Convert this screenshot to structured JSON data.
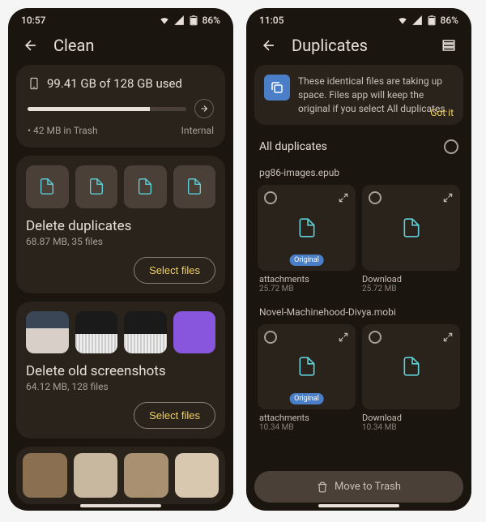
{
  "left": {
    "status": {
      "time": "10:57",
      "battery": "86%"
    },
    "title": "Clean",
    "storage": {
      "used_text": "99.41 GB of 128 GB used",
      "trash": "42 MB in Trash",
      "label": "Internal",
      "percent": 77
    },
    "dup": {
      "title": "Delete duplicates",
      "sub": "68.87 MB, 35 files",
      "btn": "Select files"
    },
    "ss": {
      "title": "Delete old screenshots",
      "sub": "64.12 MB, 128 files",
      "btn": "Select files"
    }
  },
  "right": {
    "status": {
      "time": "11:05",
      "battery": "86%"
    },
    "title": "Duplicates",
    "banner": {
      "text": "These identical files are taking up space. Files app will keep the original if you select All duplicates.",
      "action": "Got it"
    },
    "all_label": "All duplicates",
    "groups": [
      {
        "name": "pg86-images.epub",
        "items": [
          {
            "folder": "attachments",
            "size": "25.72 MB",
            "original": true
          },
          {
            "folder": "Download",
            "size": "25.72 MB",
            "original": false
          }
        ]
      },
      {
        "name": "Novel-Machinehood-Divya.mobi",
        "items": [
          {
            "folder": "attachments",
            "size": "10.34 MB",
            "original": true
          },
          {
            "folder": "Download",
            "size": "10.34 MB",
            "original": false
          }
        ]
      }
    ],
    "bottom_btn": "Move to Trash"
  }
}
